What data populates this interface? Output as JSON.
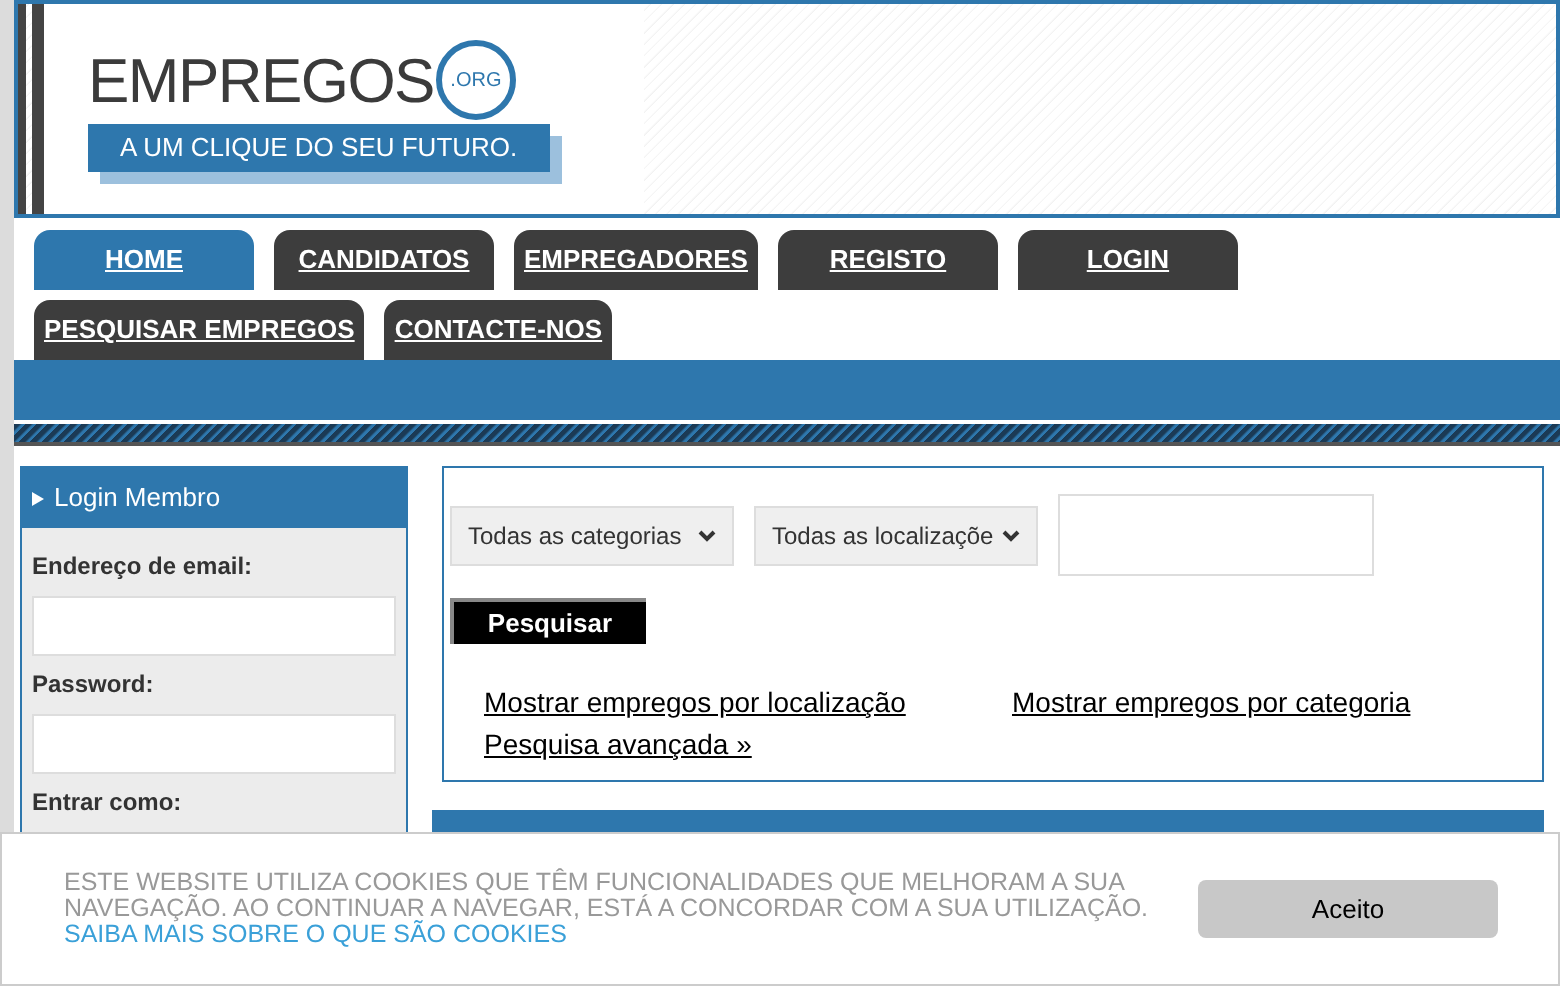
{
  "logo": {
    "name": "EMPREGOS",
    "suffix": ".ORG",
    "tagline": "A UM CLIQUE DO SEU FUTURO."
  },
  "nav": {
    "rows": [
      [
        {
          "label": "HOME",
          "selected": true
        },
        {
          "label": "CANDIDATOS",
          "selected": false
        },
        {
          "label": "EMPREGADORES",
          "selected": false
        },
        {
          "label": "REGISTO",
          "selected": false
        },
        {
          "label": "LOGIN",
          "selected": false
        }
      ],
      [
        {
          "label": "PESQUISAR EMPREGOS",
          "selected": false
        },
        {
          "label": "CONTACTE-NOS",
          "selected": false
        }
      ]
    ]
  },
  "login": {
    "title": "Login Membro",
    "email_label": "Endereço de email:",
    "password_label": "Password:",
    "role_label": "Entrar como:"
  },
  "search": {
    "category": "Todas as categorias",
    "location": "Todas as localizaçõe",
    "button": "Pesquisar",
    "links": [
      "Mostrar empregos por localização",
      "Mostrar empregos por categoria",
      "Pesquisa avançada »"
    ]
  },
  "cookie": {
    "text": "ESTE WEBSITE UTILIZA COOKIES QUE TÊM FUNCIONALIDADES QUE MELHORAM A SUA NAVEGAÇÃO. AO CONTINUAR A NAVEGAR, ESTÁ A CONCORDAR COM A SUA UTILIZAÇÃO.",
    "link": "SAIBA MAIS SOBRE O QUE SÃO COOKIES",
    "button": "Aceito"
  }
}
